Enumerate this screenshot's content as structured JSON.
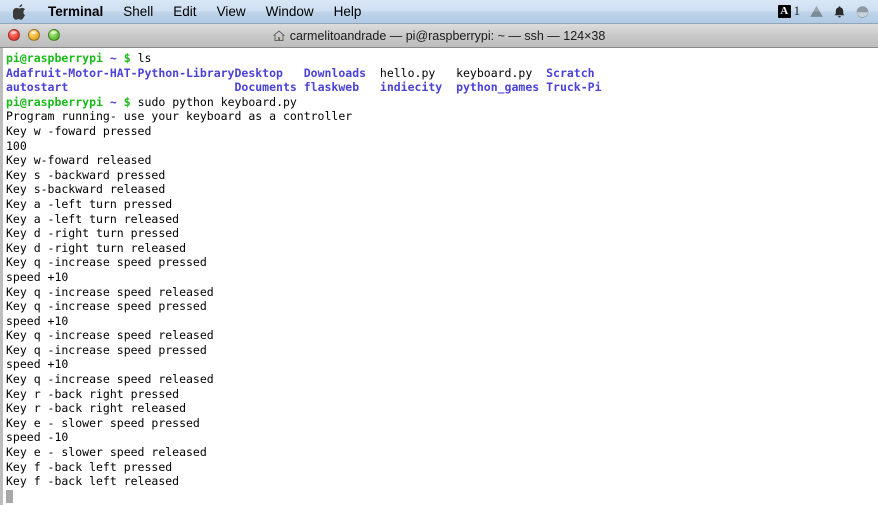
{
  "menubar": {
    "apple_icon": "apple-logo-icon",
    "items": [
      {
        "label": "Terminal",
        "bold": true
      },
      {
        "label": "Shell",
        "bold": false
      },
      {
        "label": "Edit",
        "bold": false
      },
      {
        "label": "View",
        "bold": false
      },
      {
        "label": "Window",
        "bold": false
      },
      {
        "label": "Help",
        "bold": false
      }
    ],
    "status": {
      "input_source_badge": "A",
      "input_source_count": "1",
      "drive_icon": "google-drive-icon",
      "bell_icon": "notification-bell-icon",
      "extra_icon": "circle-ellipsis-icon"
    }
  },
  "window": {
    "title": "carmelitoandrade — pi@raspberrypi: ~ — ssh — 124×38",
    "home_icon": "home-folder-icon",
    "close_button": "close-window-button",
    "minimize_button": "minimize-window-button",
    "zoom_button": "zoom-window-button"
  },
  "terminal": {
    "prompt": {
      "user_host": "pi@raspberrypi",
      "path": "~",
      "sigil": "$"
    },
    "commands": {
      "first": "ls",
      "second": "sudo python keyboard.py"
    },
    "ls_output": {
      "rows": [
        [
          {
            "text": "Adafruit-Motor-HAT-Python-Library",
            "type": "dir"
          },
          {
            "text": "Desktop",
            "type": "dir"
          },
          {
            "text": "Downloads",
            "type": "dir"
          },
          {
            "text": "hello.py",
            "type": "file"
          },
          {
            "text": "keyboard.py",
            "type": "file"
          },
          {
            "text": "Scratch",
            "type": "dir"
          }
        ],
        [
          {
            "text": "autostart",
            "type": "dir"
          },
          {
            "text": "Documents",
            "type": "dir"
          },
          {
            "text": "flaskweb",
            "type": "dir"
          },
          {
            "text": "indiecity",
            "type": "dir"
          },
          {
            "text": "python_games",
            "type": "dir"
          },
          {
            "text": "Truck-Pi",
            "type": "dir"
          }
        ]
      ],
      "column_starts": [
        0,
        33,
        43,
        54,
        65,
        78
      ]
    },
    "program_output": [
      "Program running- use your keyboard as a controller",
      "Key w -foward pressed",
      "100",
      "Key w-foward released",
      "Key s -backward pressed",
      "Key s-backward released",
      "Key a -left turn pressed",
      "Key a -left turn released",
      "Key d -right turn pressed",
      "Key d -right turn released",
      "Key q -increase speed pressed",
      "speed +10",
      "Key q -increase speed released",
      "Key q -increase speed pressed",
      "speed +10",
      "Key q -increase speed released",
      "Key q -increase speed pressed",
      "speed +10",
      "Key q -increase speed released",
      "Key r -back right pressed",
      "Key r -back right released",
      "Key e - slower speed pressed",
      "speed -10",
      "Key e - slower speed released",
      "Key f -back left pressed",
      "Key f -back left released"
    ],
    "colors": {
      "directory": "#4b42d6",
      "file": "#000000",
      "prompt_green": "#1bba1b",
      "prompt_blue": "#4b42d6",
      "background": "#ffffff",
      "cursor": "#a8a8a8"
    }
  }
}
